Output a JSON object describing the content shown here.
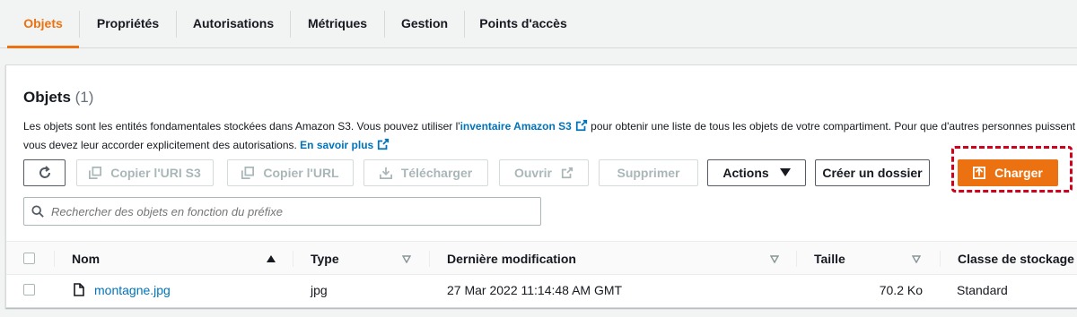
{
  "tabs": [
    {
      "label": "Objets",
      "active": true
    },
    {
      "label": "Propriétés"
    },
    {
      "label": "Autorisations"
    },
    {
      "label": "Métriques"
    },
    {
      "label": "Gestion"
    },
    {
      "label": "Points d'accès"
    }
  ],
  "panel": {
    "title": "Objets",
    "count": "(1)",
    "desc_line1_before": "Les objets sont les entités fondamentales stockées dans Amazon S3. Vous pouvez utiliser l'",
    "desc_link1": "inventaire Amazon S3",
    "desc_line1_after": " pour obtenir une liste de tous les objets de votre compartiment. Pour que d'autres personnes puissent",
    "desc_line2_before": "vous devez leur accorder explicitement des autorisations.",
    "desc_link2": "En savoir plus"
  },
  "toolbar": {
    "copy_uri": "Copier l'URI S3",
    "copy_url": "Copier l'URL",
    "download": "Télécharger",
    "open": "Ouvrir",
    "delete": "Supprimer",
    "actions": "Actions",
    "create_folder": "Créer un dossier",
    "upload": "Charger"
  },
  "search": {
    "placeholder": "Rechercher des objets en fonction du préfixe"
  },
  "table": {
    "columns": [
      "Nom",
      "Type",
      "Dernière modification",
      "Taille",
      "Classe de stockage"
    ],
    "rows": [
      {
        "name": "montagne.jpg",
        "type": "jpg",
        "modified": "27 Mar 2022 11:14:48 AM GMT",
        "size": "70.2 Ko",
        "storage": "Standard"
      }
    ]
  },
  "colors": {
    "accent": "#ec7211",
    "link": "#0073bb",
    "highlight": "#d0021b"
  }
}
